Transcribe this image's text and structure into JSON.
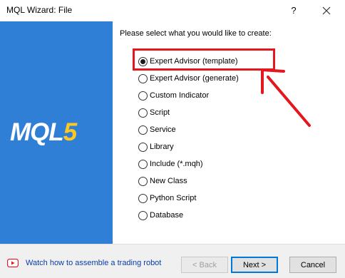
{
  "window": {
    "title": "MQL Wizard: File",
    "help_label": "?"
  },
  "banner": {
    "logo_main": "MQL",
    "logo_accent": "5",
    "logo_color": "#2f7fd6",
    "accent_color": "#ffc81e"
  },
  "content": {
    "prompt": "Please select what you would like to create:",
    "selected_index": 0,
    "options": [
      {
        "label": "Expert Advisor (template)",
        "checked": true
      },
      {
        "label": "Expert Advisor (generate)",
        "checked": false
      },
      {
        "label": "Custom Indicator",
        "checked": false
      },
      {
        "label": "Script",
        "checked": false
      },
      {
        "label": "Service",
        "checked": false
      },
      {
        "label": "Library",
        "checked": false
      },
      {
        "label": "Include (*.mqh)",
        "checked": false
      },
      {
        "label": "New Class",
        "checked": false
      },
      {
        "label": "Python Script",
        "checked": false
      },
      {
        "label": "Database",
        "checked": false
      }
    ]
  },
  "annotation": {
    "highlight_color": "#e4161e"
  },
  "footer": {
    "help_link": "Watch how to assemble a trading robot",
    "back_label": "< Back",
    "next_label": "Next >",
    "cancel_label": "Cancel"
  }
}
